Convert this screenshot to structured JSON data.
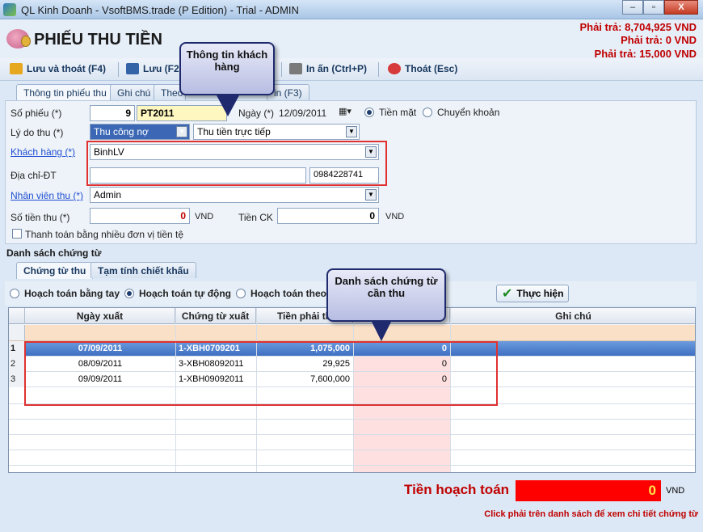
{
  "window": {
    "title": "QL Kinh Doanh - VsoftBMS.trade (P Edition) - Trial - ADMIN",
    "minimize": "–",
    "maximize": "▫",
    "close": "X"
  },
  "header": {
    "title": "PHIẾU THU TIỀN",
    "pay_lines": [
      "Phải trả: 8,704,925 VND",
      "Phải trả: 0 VND",
      "Phải trả: 15,000 VND"
    ]
  },
  "toolbar": {
    "save_close": "Lưu và thoát (F4)",
    "save": "Lưu (F2)",
    "print": "In ấn (Ctrl+P)",
    "exit": "Thoát (Esc)"
  },
  "tabs_top": [
    "Thông tin phiếu thu",
    "Ghi chú",
    "Theo",
    "in (F3)"
  ],
  "form": {
    "so_phieu_label": "Số phiếu (*)",
    "so_phieu_num": "9",
    "so_phieu_code": "PT2011",
    "ngay_label": "Ngày (*)",
    "ngay_value": "12/09/2011",
    "tien_mat": "Tiền mặt",
    "chuyen_khoan": "Chuyển khoản",
    "ly_do_label": "Lý do thu (*)",
    "ly_do_value": "Thu công nợ",
    "ly_do_detail": "Thu tiền trực tiếp",
    "khach_hang_label": "Khách hàng (*)",
    "khach_hang_value": "BinhLV",
    "dia_chi_label": "Địa chỉ-ĐT",
    "dia_chi_value": "",
    "dien_thoai": "0984228741",
    "nhan_vien_label": "Nhân viên thu (*)",
    "nhan_vien_value": "Admin",
    "so_tien_label": "Số tiền thu (*)",
    "so_tien_value": "0",
    "vnd": "VND",
    "tien_ck_label": "Tiền CK",
    "tien_ck_value": "0",
    "multi_currency": "Thanh toán bằng nhiều đơn vị tiền tệ"
  },
  "callouts": {
    "customer_info": "Thông tin khách hàng",
    "documents": "Danh sách chứng từ cần thu"
  },
  "section": {
    "title": "Danh sách chứng từ",
    "tabs": [
      "Chứng từ thu",
      "Tạm tính chiết khấu"
    ],
    "radio_manual": "Hoạch toán bằng tay",
    "radio_auto": "Hoạch toán tự động",
    "radio_by": "Hoạch toán theo",
    "execute": "Thực hiện"
  },
  "grid": {
    "columns": [
      "Ngày xuất",
      "Chứng từ xuất",
      "Tiền phải th",
      "",
      "Ghi chú"
    ],
    "rows": [
      {
        "no": "1",
        "date": "07/09/2011",
        "doc": "1-XBH0709201",
        "amount": "1,075,000",
        "pay": "0"
      },
      {
        "no": "2",
        "date": "08/09/2011",
        "doc": "3-XBH08092011",
        "amount": "29,925",
        "pay": "0"
      },
      {
        "no": "3",
        "date": "09/09/2011",
        "doc": "1-XBH09092011",
        "amount": "7,600,000",
        "pay": "0"
      }
    ]
  },
  "footer": {
    "total_label": "Tiền hoạch toán",
    "total_value": "0",
    "total_unit": "VND",
    "hint": "Click phải trên danh sách để xem chi tiết chứng từ"
  }
}
